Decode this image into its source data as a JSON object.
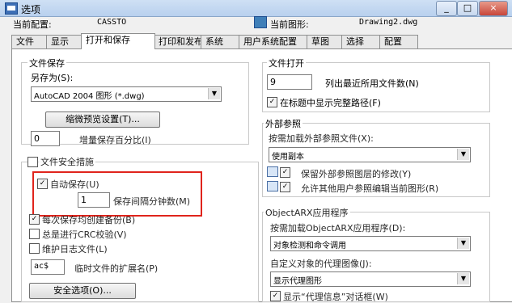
{
  "window": {
    "title": "选项",
    "buttons": {
      "min": "_",
      "max": "□",
      "close": "×"
    }
  },
  "profile": {
    "label": "当前配置:",
    "value": "CASSTO"
  },
  "drawing": {
    "label": "当前图形:",
    "value": "Drawing2.dwg"
  },
  "tabs": [
    "文件",
    "显示",
    "打开和保存",
    "打印和发布",
    "系统",
    "用户系统配置",
    "草图",
    "选择",
    "配置"
  ],
  "active_tab": "打开和保存",
  "file_save": {
    "group_title": "文件保存",
    "save_as_label": "另存为(S):",
    "save_as_value": "AutoCAD 2004 图形 (*.dwg)",
    "thumb_button": "缩微预览设置(T)...",
    "increment_value": "0",
    "increment_label": "增量保存百分比(I)"
  },
  "safety": {
    "group_title": "文件安全措施",
    "autosave_label": "自动保存(U)",
    "autosave_minutes_value": "1",
    "autosave_minutes_label": "保存间隔分钟数(M)",
    "backup_label": "每次保存均创建备份(B)",
    "crc_label": "总是进行CRC校验(V)",
    "log_label": "维护日志文件(L)",
    "temp_ext_value": "ac$",
    "temp_ext_label": "临时文件的扩展名(P)",
    "security_button": "安全选项(O)..."
  },
  "file_open": {
    "group_title": "文件打开",
    "recent_value": "9",
    "recent_label": "列出最近所用文件数(N)",
    "fullpath_label": "在标题中显示完整路径(F)"
  },
  "xref": {
    "group_title": "外部参照",
    "demand_label": "按需加载外部参照文件(X):",
    "demand_value": "使用副本",
    "retain_label": "保留外部参照图层的修改(Y)",
    "edit_label": "允许其他用户参照编辑当前图形(R)"
  },
  "objectarx": {
    "group_title": "ObjectARX应用程序",
    "demand_label": "按需加载ObjectARX应用程序(D):",
    "demand_value": "对象检测和命令调用",
    "proxy_label": "自定义对象的代理图像(J):",
    "proxy_value": "显示代理图形",
    "proxy_warn_label": "显示“代理信息”对话框(W)"
  }
}
